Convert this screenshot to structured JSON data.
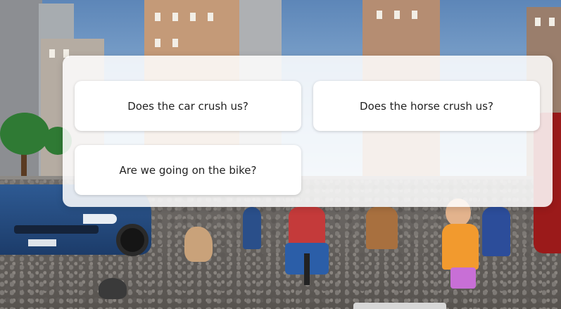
{
  "dialog": {
    "choices": [
      {
        "label": "Does the car crush us?"
      },
      {
        "label": "Does the horse crush us?"
      },
      {
        "label": "Are we going on the bike?"
      }
    ]
  },
  "colors": {
    "sky": "#7a9cc0",
    "dialog_bg": "#ffffff",
    "text": "#222222",
    "car": "#2e5a93"
  }
}
